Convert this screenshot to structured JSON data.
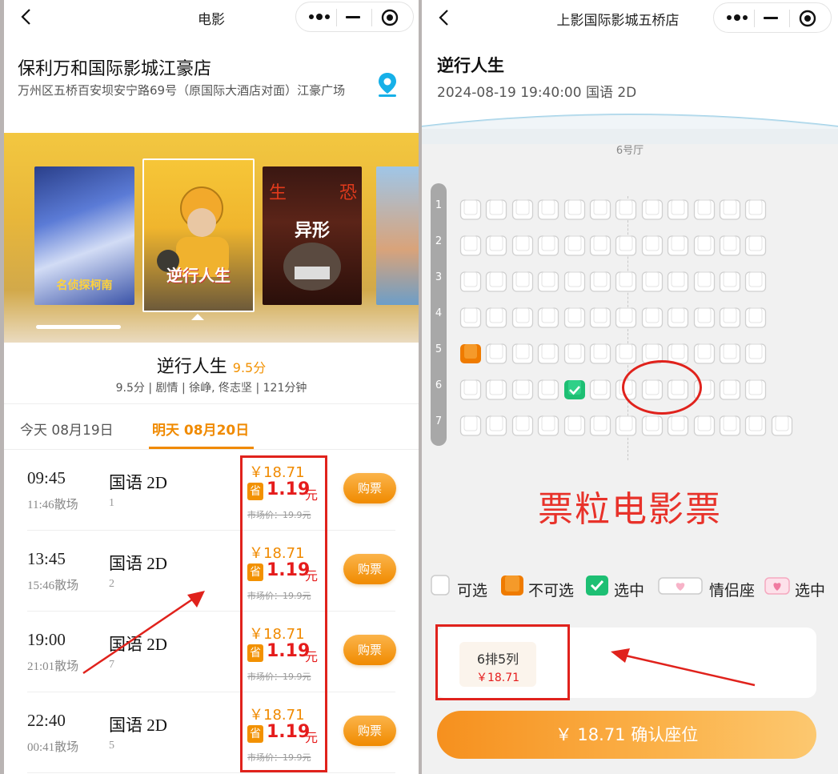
{
  "left": {
    "nav_title": "电影",
    "cinema": {
      "name": "保利万和国际影城江豪店",
      "address": "万州区五桥百安坝安宁路69号（原国际大酒店对面）江豪广场"
    },
    "posters": [
      {
        "title": "名侦探柯南"
      },
      {
        "title": "逆行人生"
      },
      {
        "title": "异形"
      },
      {
        "title": ""
      }
    ],
    "movie": {
      "title": "逆行人生",
      "score": "9.5分",
      "meta": "9.5分 | 剧情 | 徐峥, 佟志坚 | 121分钟"
    },
    "date_tabs": [
      "今天 08月19日",
      "明天 08月20日"
    ],
    "active_tab": 1,
    "showings": [
      {
        "time": "09:45",
        "end": "11:46散场",
        "lang": "国语 2D",
        "hall": "1",
        "price": "￥18.71",
        "save_badge": "省",
        "save": "1.19",
        "unit": "元",
        "market": "市场价：19.9元",
        "buy": "购票"
      },
      {
        "time": "13:45",
        "end": "15:46散场",
        "lang": "国语 2D",
        "hall": "2",
        "price": "￥18.71",
        "save_badge": "省",
        "save": "1.19",
        "unit": "元",
        "market": "市场价：19.9元",
        "buy": "购票"
      },
      {
        "time": "19:00",
        "end": "21:01散场",
        "lang": "国语 2D",
        "hall": "7",
        "price": "￥18.71",
        "save_badge": "省",
        "save": "1.19",
        "unit": "元",
        "market": "市场价：19.9元",
        "buy": "购票"
      },
      {
        "time": "22:40",
        "end": "00:41散场",
        "lang": "国语 2D",
        "hall": "5",
        "price": "￥18.71",
        "save_badge": "省",
        "save": "1.19",
        "unit": "元",
        "market": "市场价：19.9元",
        "buy": "购票"
      }
    ]
  },
  "right": {
    "nav_title": "上影国际影城五桥店",
    "movie_title": "逆行人生",
    "session": "2024-08-19 19:40:00 国语 2D",
    "hall": "6号厅",
    "rows": [
      "1",
      "2",
      "3",
      "4",
      "5",
      "6",
      "7"
    ],
    "seats_per_row": [
      12,
      12,
      12,
      12,
      12,
      12,
      13
    ],
    "unavailable": [
      {
        "row": 5,
        "col": 1
      }
    ],
    "selected": [
      {
        "row": 6,
        "col": 5
      }
    ],
    "watermark": "票粒电影票",
    "legend": [
      "可选",
      "不可选",
      "选中",
      "情侣座",
      "选中"
    ],
    "selection": {
      "seat": "6排5列",
      "price": "￥18.71"
    },
    "confirm": "￥ 18.71 确认座位"
  },
  "colors": {
    "accent": "#f08a00",
    "price_red": "#e51c1c",
    "selected_green": "#1dbf73",
    "unavailable_orange": "#ef7b00",
    "annotation_red": "#e0221c"
  }
}
